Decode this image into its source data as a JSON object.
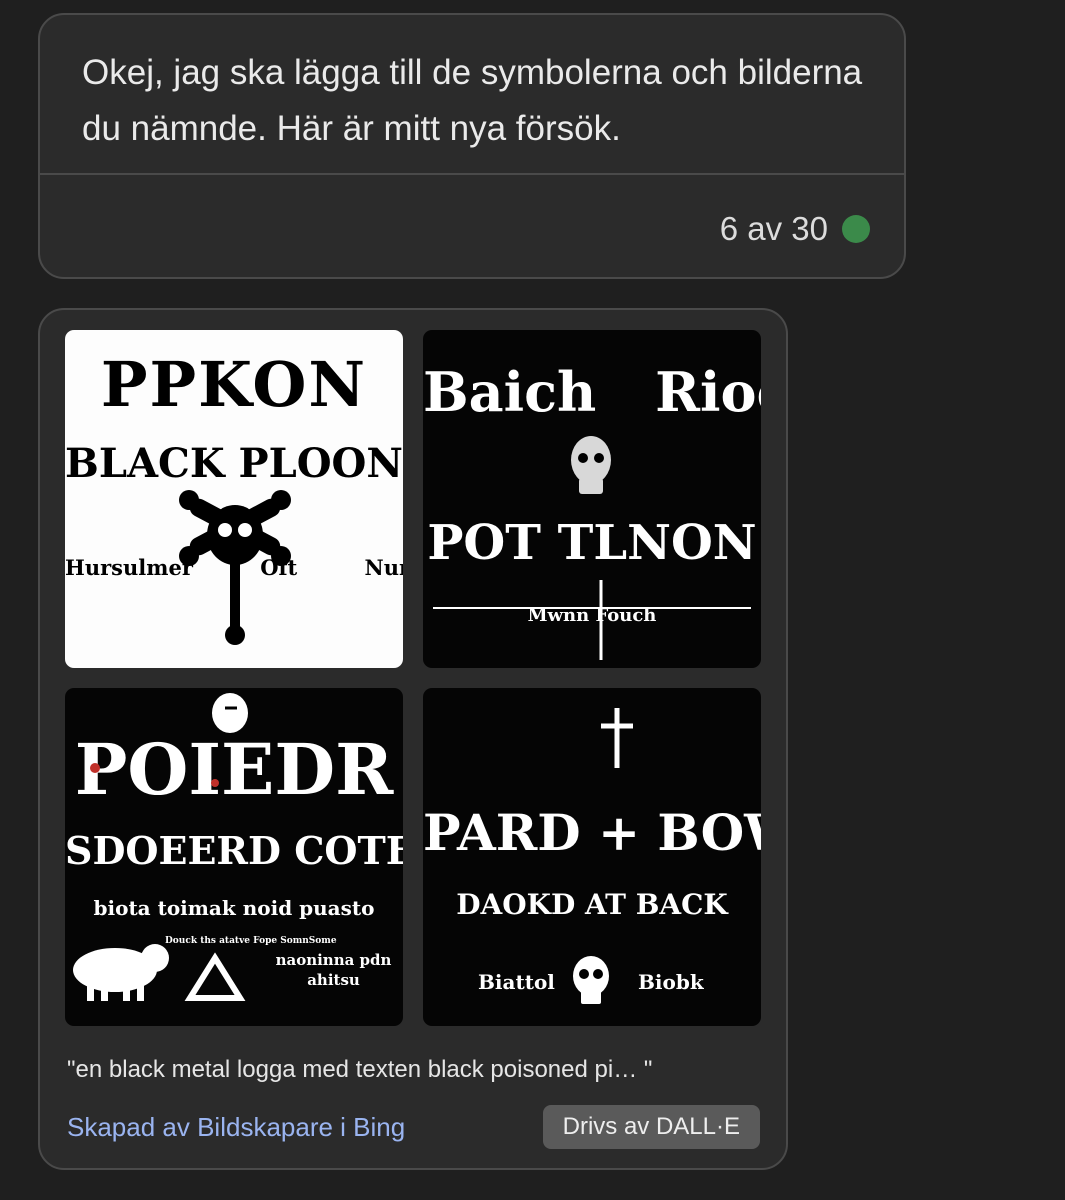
{
  "message": {
    "text": "Okej, jag ska lägga till de symbolerna och bilderna du nämnde. Här är mitt nya försök.",
    "counter": "6 av 30",
    "status_color": "#3b8a4a"
  },
  "image_card": {
    "images": [
      {
        "icon": "skull-crossbones",
        "lines": [
          "PPKON",
          "BLACK PLOON",
          "Hursulmer  Oft Nunn"
        ]
      },
      {
        "icon": "skull",
        "lines": [
          "Baich  Riock",
          "POT TLNON",
          "Mwnn Fouch"
        ]
      },
      {
        "icon": "skull-pig-symbol",
        "lines": [
          "POIEDR",
          "SDOEERD COTENT",
          "biota toimak noid puasto",
          "Douck ths atatve Fope SomnSome",
          "naoninna pdn ahitsu"
        ]
      },
      {
        "icon": "cross-skull",
        "lines": [
          "PARD + BOWN",
          "DAOKD AT BACK",
          "Biattol",
          "Biobk"
        ]
      }
    ],
    "prompt": "\"en black metal logga med texten black poisoned pi… \"",
    "creator_link": "Skapad av Bildskapare i Bing",
    "powered_by": "Drivs av DALL·E"
  }
}
